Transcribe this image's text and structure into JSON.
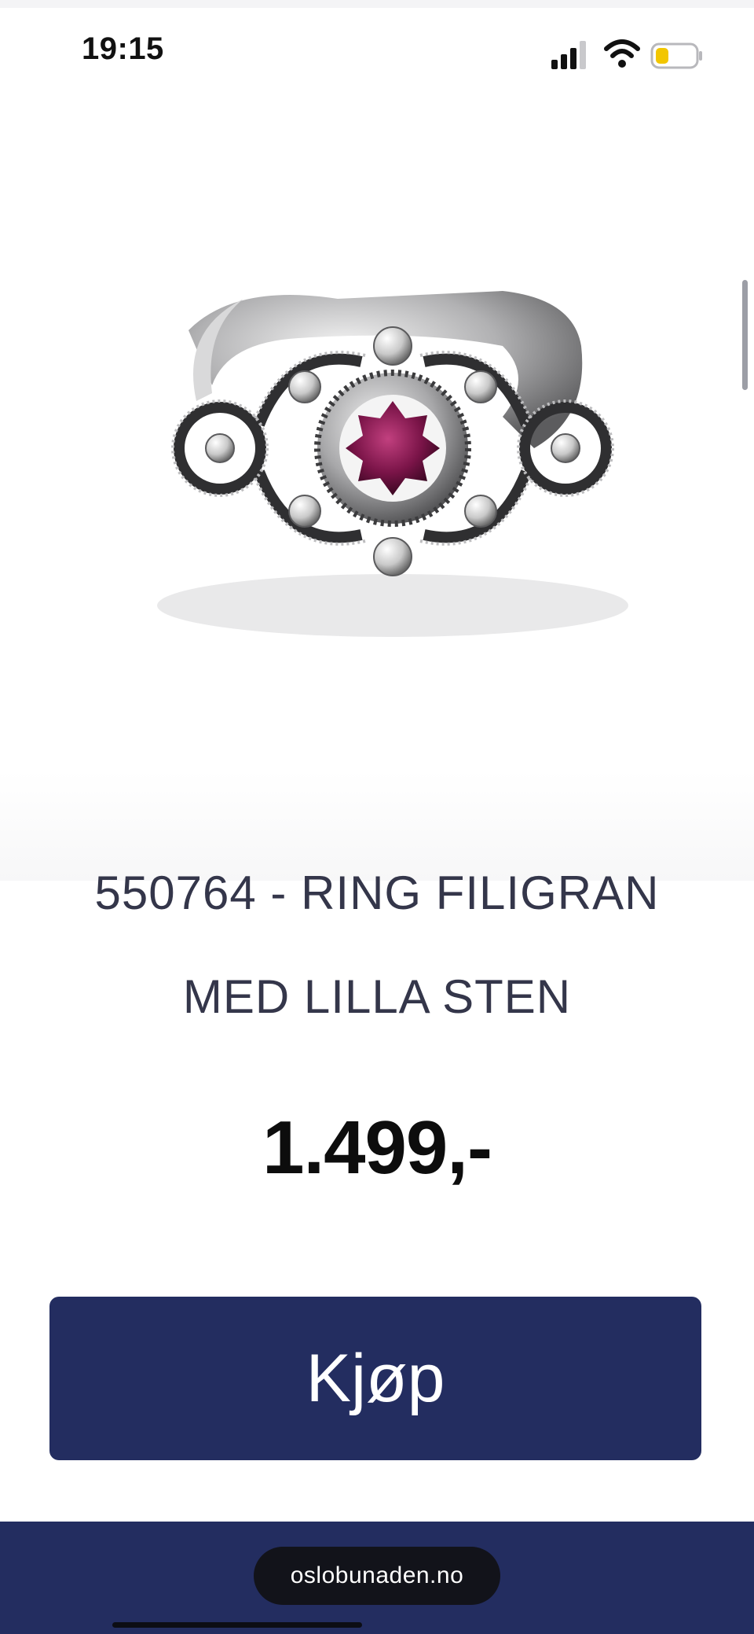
{
  "status_bar": {
    "time": "19:15",
    "battery_color": "#f2c600"
  },
  "product": {
    "title_line1": "550764 - RING FILIGRAN",
    "title_line2": "MED LILLA STEN",
    "price": "1.499,-",
    "image_icon": "filigree-ring-icon",
    "stone_color": "#7a1448"
  },
  "actions": {
    "buy_label": "Kjøp",
    "buy_color": "#232d60"
  },
  "browser": {
    "url": "oslobunaden.no"
  }
}
